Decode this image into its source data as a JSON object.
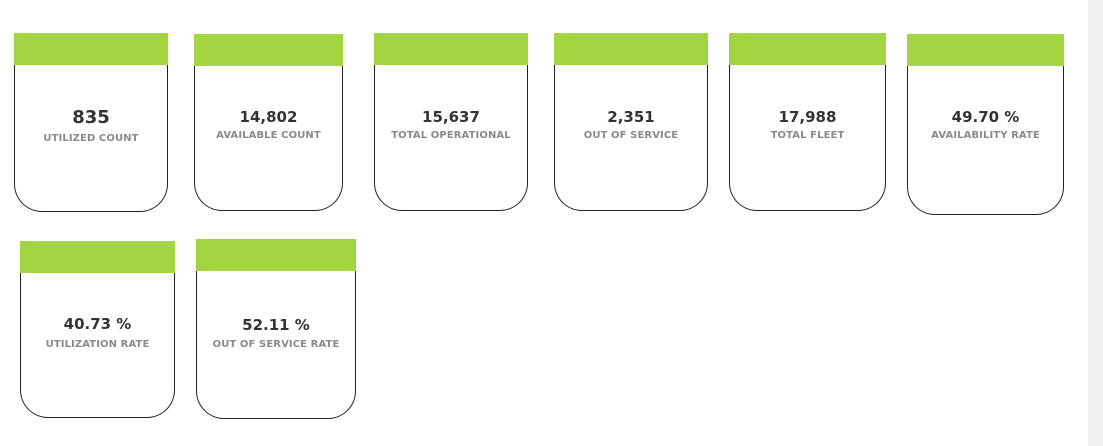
{
  "theme": {
    "accent": "#a3d543",
    "border": "#222222",
    "value_color": "#333333",
    "label_color": "#8a8a8a"
  },
  "kpis": [
    {
      "value": "835",
      "label": "UTILIZED COUNT"
    },
    {
      "value": "14,802",
      "label": "AVAILABLE COUNT"
    },
    {
      "value": "15,637",
      "label": "TOTAL OPERATIONAL"
    },
    {
      "value": "2,351",
      "label": "OUT OF SERVICE"
    },
    {
      "value": "17,988",
      "label": "TOTAL FLEET"
    },
    {
      "value": "49.70 %",
      "label": "AVAILABILITY RATE"
    },
    {
      "value": "40.73 %",
      "label": "UTILIZATION RATE"
    },
    {
      "value": "52.11 %",
      "label": "OUT OF SERVICE RATE"
    }
  ]
}
